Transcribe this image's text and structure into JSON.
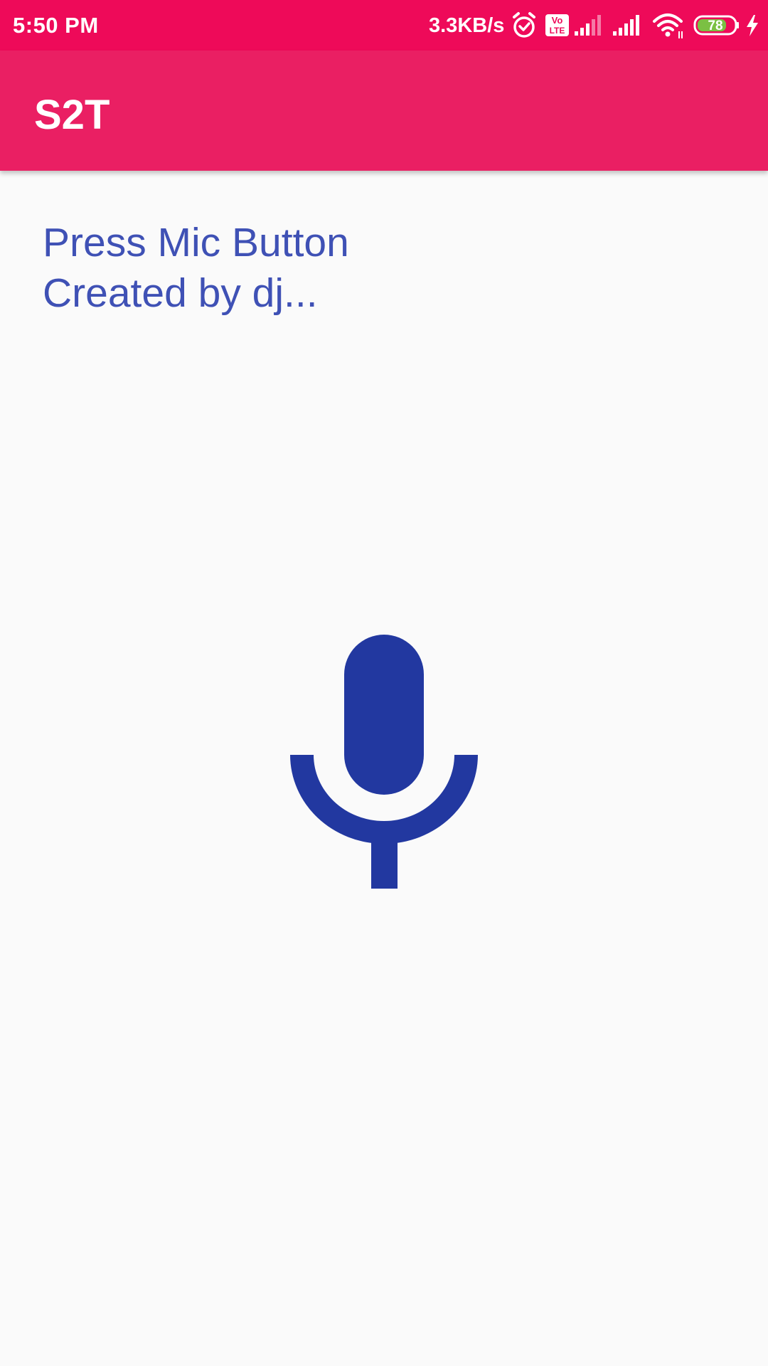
{
  "status_bar": {
    "time": "5:50 PM",
    "network_speed": "3.3KB/s",
    "volte_top": "Vo",
    "volte_bottom": "LTE",
    "battery_level": "78",
    "icons": [
      "alarm-icon",
      "volte-icon",
      "signal-icon",
      "signal-icon",
      "wifi-icon",
      "battery-icon",
      "charging-icon"
    ],
    "background_color": "#EE0A59"
  },
  "app_bar": {
    "title": "S2T",
    "background_color": "#EA1F63"
  },
  "main": {
    "prompt_line_1": "Press Mic Button",
    "prompt_line_2": "Created by dj...",
    "text_color": "#3F51B5",
    "mic_button": {
      "icon": "microphone-icon",
      "color": "#2238A0"
    }
  }
}
